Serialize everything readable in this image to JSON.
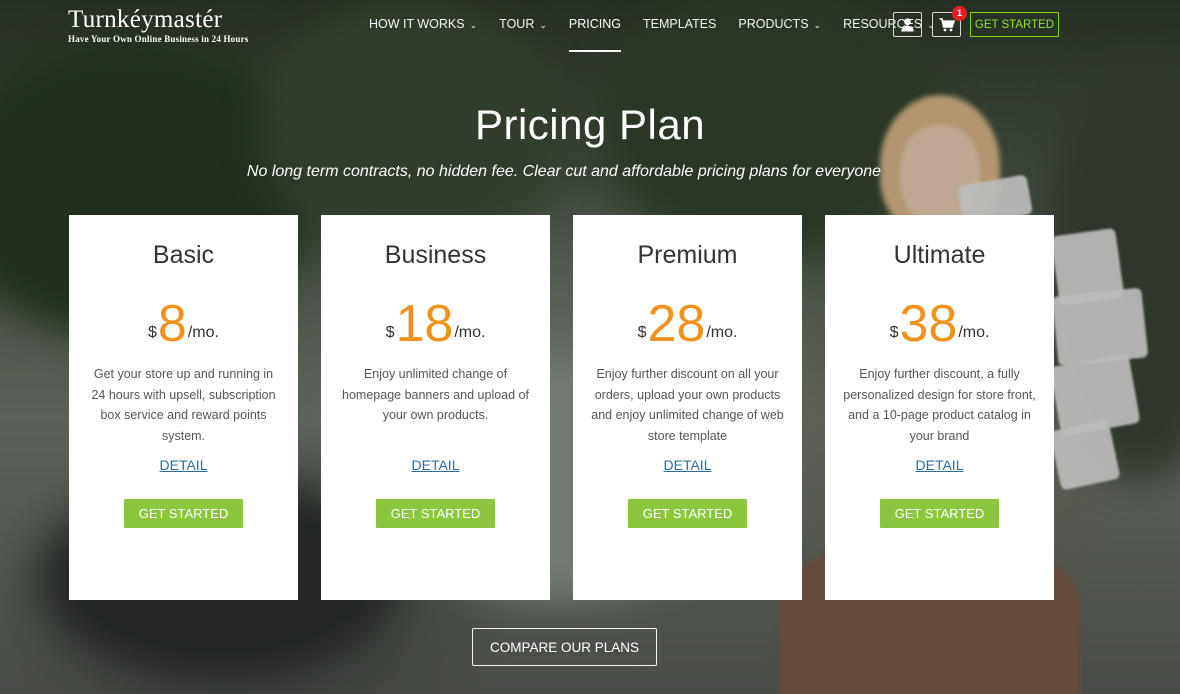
{
  "brand": {
    "name": "Turnkéymastér",
    "tagline": "Have Your Own Online Business in 24 Hours"
  },
  "nav": {
    "items": [
      {
        "label": "HOW IT WORKS",
        "dropdown": true
      },
      {
        "label": "TOUR",
        "dropdown": true
      },
      {
        "label": "PRICING",
        "dropdown": false,
        "active": true
      },
      {
        "label": "TEMPLATES",
        "dropdown": false
      },
      {
        "label": "PRODUCTS",
        "dropdown": true
      },
      {
        "label": "RESOURCES",
        "dropdown": true
      }
    ],
    "chevron": "⌄",
    "user_icon": "user-icon",
    "cart_icon": "cart-icon",
    "cart_count": "1",
    "cta_label": "GET STARTED"
  },
  "hero": {
    "title": "Pricing Plan",
    "subtitle": "No long term contracts, no hidden fee. Clear cut and affordable pricing plans for everyone"
  },
  "plans": [
    {
      "name": "Basic",
      "currency": "$",
      "amount": "8",
      "period": "/mo.",
      "description": "Get your store up and running in 24 hours with upsell, subscription box service and reward points system.",
      "detail_label": "DETAIL",
      "button_label": "GET STARTED"
    },
    {
      "name": "Business",
      "currency": "$",
      "amount": "18",
      "period": "/mo.",
      "description": "Enjoy unlimited change of homepage banners and upload of your own products.",
      "detail_label": "DETAIL",
      "button_label": "GET STARTED"
    },
    {
      "name": "Premium",
      "currency": "$",
      "amount": "28",
      "period": "/mo.",
      "description": "Enjoy further discount on all your orders, upload your own products and enjoy unlimited change of web store template",
      "detail_label": "DETAIL",
      "button_label": "GET STARTED"
    },
    {
      "name": "Ultimate",
      "currency": "$",
      "amount": "38",
      "period": "/mo.",
      "description": "Enjoy further discount, a fully personalized design for store front, and a 10-page product catalog in your brand",
      "detail_label": "DETAIL",
      "button_label": "GET STARTED"
    }
  ],
  "compare_label": "COMPARE OUR PLANS",
  "colors": {
    "price_accent": "#f0931d",
    "button_green": "#8cc63f",
    "header_cta_green": "#7ed321",
    "detail_link": "#2e6c9e",
    "badge_red": "#e02020"
  }
}
